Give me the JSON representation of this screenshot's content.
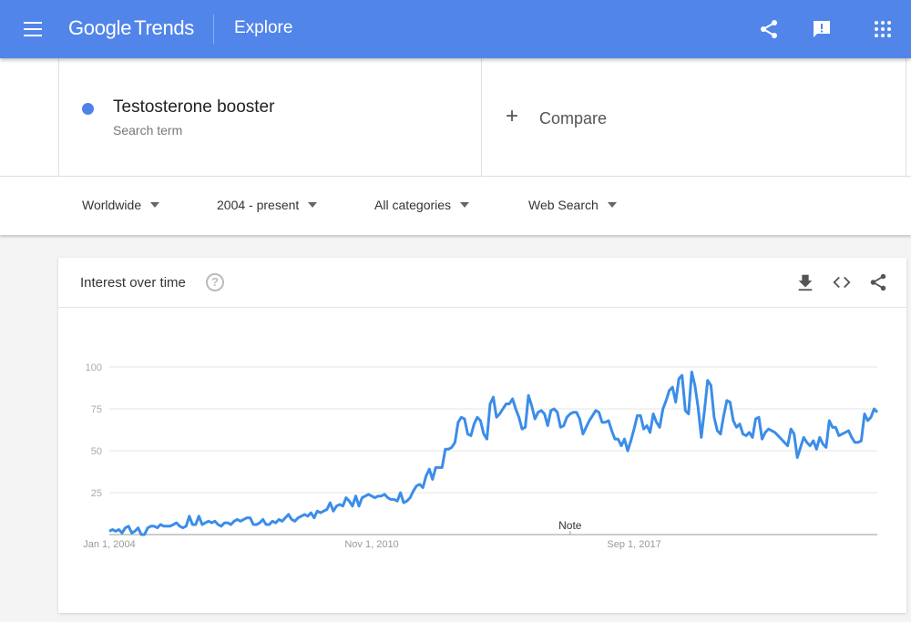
{
  "header": {
    "logo_google": "Google",
    "logo_trends": "Trends",
    "page_title": "Explore",
    "icons": [
      "menu-icon",
      "share-icon",
      "feedback-icon",
      "apps-icon"
    ]
  },
  "search": {
    "term": "Testosterone booster",
    "term_sub": "Search term",
    "term_color": "#4f82e8",
    "compare_label": "Compare",
    "compare_icon": "+"
  },
  "filters": [
    {
      "label": "Worldwide"
    },
    {
      "label": "2004 - present"
    },
    {
      "label": "All categories"
    },
    {
      "label": "Web Search"
    }
  ],
  "card": {
    "title": "Interest over time",
    "help_icon": "?",
    "icons": [
      "download-icon",
      "embed-icon",
      "share-icon"
    ]
  },
  "chart_data": {
    "type": "line",
    "title": "Interest over time",
    "xlabel": "",
    "ylabel": "",
    "ylim": [
      0,
      100
    ],
    "yticks": [
      25,
      50,
      75,
      100
    ],
    "ytick_labels": [
      "25",
      "50",
      "75",
      "100"
    ],
    "xtick_labels": [
      "Jan 1, 2004",
      "Nov 1, 2010",
      "Sep 1, 2017"
    ],
    "xtick_months": [
      0,
      82,
      164
    ],
    "annotation": {
      "label": "Note",
      "month": 144
    },
    "grid": true,
    "legend": "none",
    "series": [
      {
        "name": "Testosterone booster",
        "color": "#3b8de8",
        "start": "Jan 2004",
        "interval": "month",
        "values": [
          2,
          3,
          2,
          3,
          1,
          4,
          5,
          1,
          2,
          4,
          0,
          0,
          4,
          5,
          5,
          4,
          6,
          5,
          5,
          5,
          6,
          7,
          5,
          4,
          5,
          11,
          6,
          6,
          11,
          6,
          7,
          8,
          7,
          8,
          6,
          5,
          7,
          7,
          6,
          8,
          9,
          8,
          9,
          10,
          10,
          6,
          6,
          7,
          9,
          6,
          6,
          8,
          7,
          9,
          8,
          10,
          12,
          9,
          8,
          10,
          11,
          12,
          11,
          13,
          10,
          14,
          13,
          14,
          15,
          19,
          14,
          17,
          18,
          17,
          22,
          20,
          17,
          23,
          17,
          22,
          23,
          24,
          23,
          22,
          23,
          23,
          24,
          22,
          21,
          21,
          20,
          25,
          19,
          20,
          22,
          26,
          29,
          30,
          28,
          35,
          39,
          33,
          40,
          40,
          40,
          51,
          51,
          52,
          55,
          67,
          70,
          69,
          60,
          59,
          66,
          70,
          68,
          60,
          57,
          78,
          82,
          70,
          72,
          75,
          78,
          78,
          81,
          75,
          70,
          63,
          64,
          83,
          77,
          69,
          73,
          74,
          72,
          65,
          74,
          75,
          73,
          64,
          65,
          70,
          72,
          73,
          73,
          69,
          60,
          64,
          68,
          71,
          74,
          73,
          67,
          67,
          68,
          62,
          57,
          57,
          53,
          57,
          50,
          56,
          63,
          71,
          71,
          63,
          65,
          61,
          72,
          67,
          64,
          75,
          80,
          86,
          88,
          79,
          93,
          95,
          74,
          72,
          97,
          89,
          76,
          58,
          74,
          92,
          89,
          70,
          62,
          60,
          71,
          80,
          79,
          68,
          64,
          66,
          60,
          59,
          61,
          58,
          69,
          70,
          57,
          61,
          63,
          62,
          61,
          59,
          57,
          55,
          53,
          63,
          60,
          46,
          52,
          58,
          55,
          53,
          56,
          51,
          58,
          54,
          52,
          68,
          64,
          64,
          59,
          60,
          61,
          62,
          58,
          55,
          55,
          56,
          72,
          68,
          70,
          75,
          73
        ]
      }
    ]
  }
}
